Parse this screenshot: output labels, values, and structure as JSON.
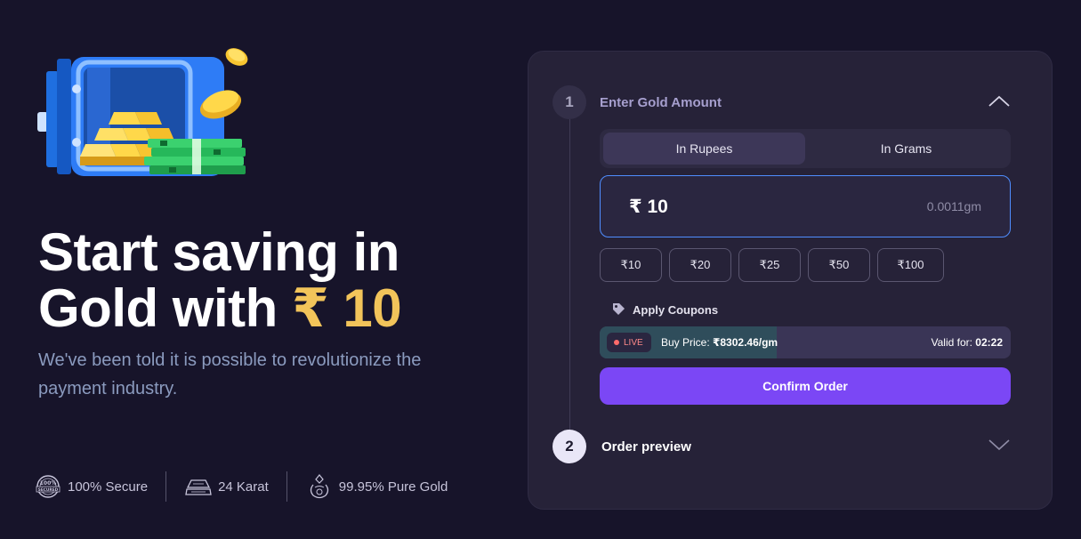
{
  "hero": {
    "title_line1": "Start saving in",
    "title_line2_prefix": "Gold with ",
    "title_line2_accent": "₹ 10",
    "subtitle": "We've been told it is possible to revolutionize the payment industry.",
    "illustration_icon": "gold-vault-with-cash-icon"
  },
  "features": [
    {
      "icon": "secured-badge-icon",
      "label": "100% Secure"
    },
    {
      "icon": "gold-bar-icon",
      "label": "24 Karat"
    },
    {
      "icon": "diamond-ring-icon",
      "label": "99.95% Pure Gold"
    }
  ],
  "order_card": {
    "step1": {
      "number": "1",
      "title": "Enter Gold Amount",
      "expanded": true,
      "toggle": {
        "options": [
          "In Rupees",
          "In Grams"
        ],
        "selected": "In Rupees"
      },
      "amount_value": "₹ 10",
      "amount_grams": "0.0011gm",
      "quick_amounts": [
        "₹10",
        "₹20",
        "₹25",
        "₹50",
        "₹100"
      ],
      "coupon_label": "Apply Coupons",
      "live_badge": "LIVE",
      "buy_price_label": "Buy Price:",
      "buy_price_value": "₹8302.46/gm",
      "valid_for_label": "Valid for:",
      "valid_for_value": "02:22",
      "timer_progress_percent": 43,
      "confirm_label": "Confirm Order"
    },
    "step2": {
      "number": "2",
      "title": "Order preview",
      "expanded": false
    }
  },
  "colors": {
    "background": "#17142a",
    "card": "#262238",
    "accent_gold": "#f2c45a",
    "primary": "#7b47f5",
    "input_border": "#4f8dff"
  }
}
